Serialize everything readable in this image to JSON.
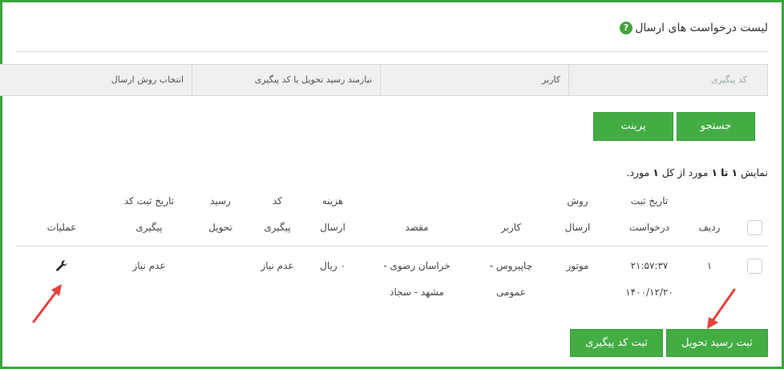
{
  "header": {
    "title": "لیست درخواست های ارسال",
    "help_icon": "?"
  },
  "filters": {
    "tracking_code": "کد پیگیری",
    "user": "کاربر",
    "needs_receipt": "نیازمند رسید تحویل یا کد پیگیری",
    "send_method": "انتخاب روش ارسال"
  },
  "buttons": {
    "search": "جستجو",
    "print": "پرینت",
    "register_receipt": "ثبت رسید تحویل",
    "register_tracking": "ثبت کد پیگیری"
  },
  "count": {
    "prefix": "نمایش",
    "from": "۱",
    "to_word": "تا",
    "to": "۱",
    "mid": "مورد از کل",
    "total": "۱",
    "suffix": "مورد."
  },
  "table": {
    "headers": {
      "row": "ردیف",
      "req_date_1": "تاریخ ثبت",
      "req_date_2": "درخواست",
      "method_1": "روش",
      "method_2": "ارسال",
      "user": "کاربر",
      "dest": "مقصد",
      "cost_1": "هزینه",
      "cost_2": "ارسال",
      "code_1": "کد",
      "code_2": "پیگیری",
      "receipt_1": "رسید",
      "receipt_2": "تحویل",
      "trk_date_1": "تاریخ ثبت کد",
      "trk_date_2": "پیگیری",
      "ops": "عملیات"
    },
    "row": {
      "index": "۱",
      "time": "۲۱:۵۷:۳۷",
      "date": "۱۴۰۰/۱۲/۲۰",
      "method": "موتور",
      "user_1": "چاپیروس -",
      "user_2": "عمومی",
      "dest_1": "خراسان رضوی -",
      "dest_2": "مشهد - سجاد",
      "cost": "۰ ریال",
      "tracking": "عدم نیاز",
      "receipt": "",
      "tracking_date": "عدم نیاز",
      "ops_icon": "wrench-icon"
    }
  },
  "colors": {
    "accent": "#43ad43",
    "annotation": "#e8413a"
  }
}
